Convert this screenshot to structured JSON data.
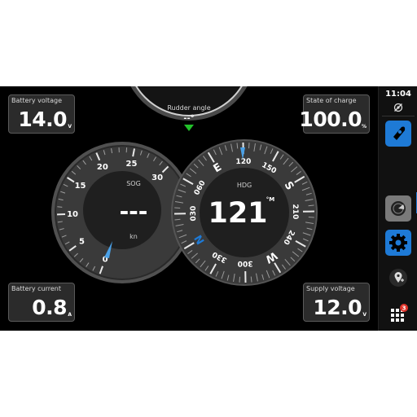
{
  "tiles": {
    "battery_voltage": {
      "label": "Battery voltage",
      "value": "14.0",
      "unit": "V"
    },
    "state_of_charge": {
      "label": "State of charge",
      "value": "100.0",
      "unit": "%"
    },
    "battery_current": {
      "label": "Battery current",
      "value": "0.8",
      "unit": "A"
    },
    "supply_voltage": {
      "label": "Supply voltage",
      "value": "12.0",
      "unit": "V"
    }
  },
  "rudder": {
    "label": "Rudder angle",
    "value": "--°"
  },
  "sog": {
    "label": "SOG",
    "value": "---",
    "unit": "kn",
    "scale": [
      "0",
      "5",
      "10",
      "15",
      "20",
      "25",
      "30"
    ]
  },
  "hdg": {
    "label": "HDG",
    "value": "121",
    "unit": "°M",
    "compass_labels": [
      "N",
      "030",
      "060",
      "E",
      "120",
      "150",
      "S",
      "210",
      "240",
      "W",
      "300",
      "330"
    ]
  },
  "sidebar": {
    "time": "11:04",
    "notification_count": "3"
  },
  "colors": {
    "accent": "#1e7ad6",
    "needle": "#4aa0e6",
    "rudder_marker": "#22c02a"
  }
}
